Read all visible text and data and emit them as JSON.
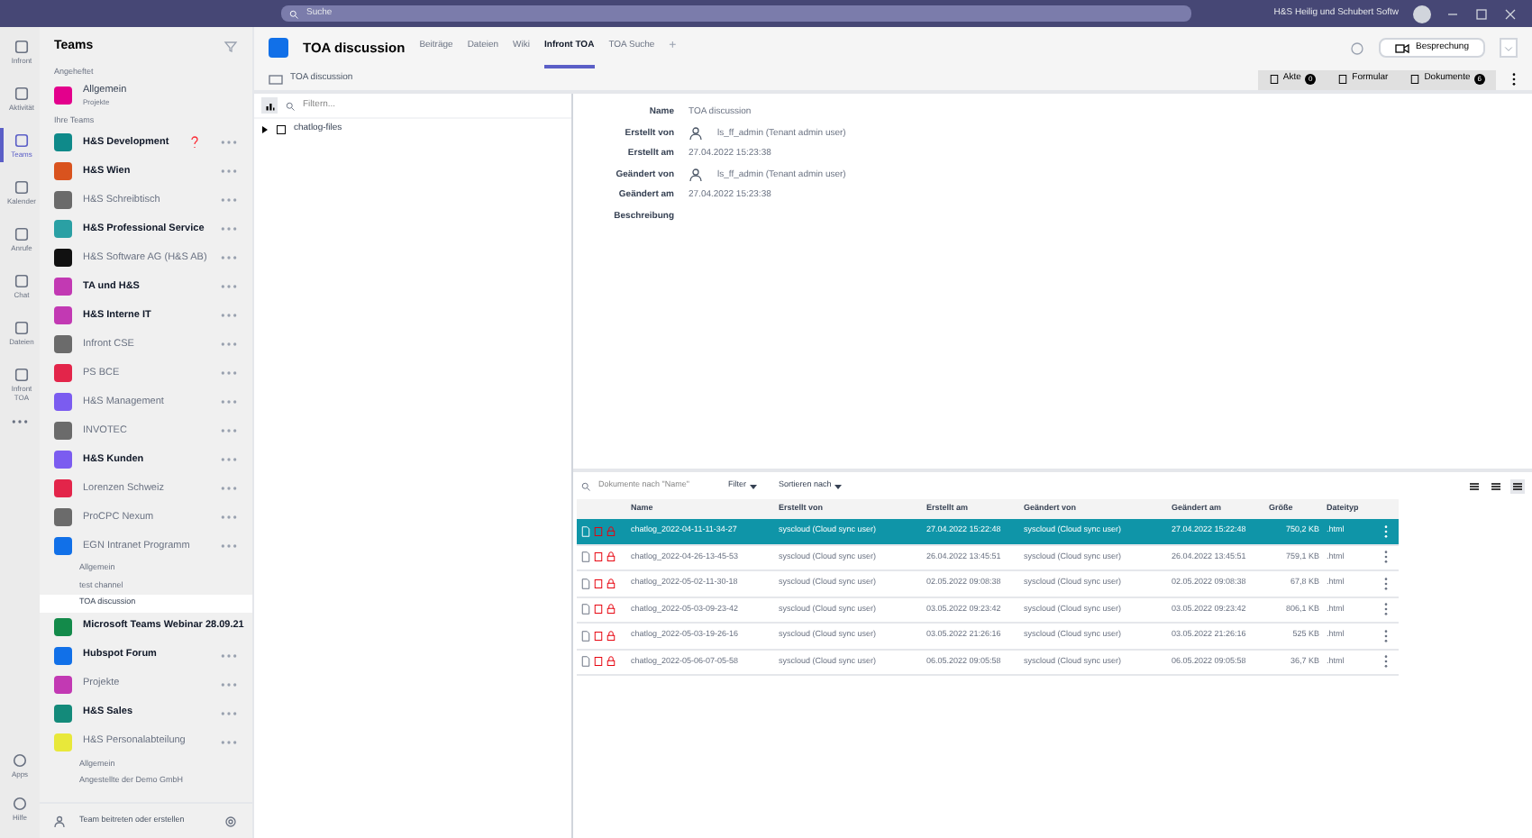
{
  "top_bar": {
    "search_placeholder": "Suche",
    "tenant": "H&S Heilig und Schubert Softw"
  },
  "rail": [
    {
      "label": "Infront",
      "selected": false
    },
    {
      "label": "Aktivität",
      "selected": false
    },
    {
      "label": "Teams",
      "selected": true
    },
    {
      "label": "Kalender",
      "selected": false
    },
    {
      "label": "Anrufe",
      "selected": false
    },
    {
      "label": "Chat",
      "selected": false
    },
    {
      "label": "Dateien",
      "selected": false
    },
    {
      "label": "Infront TOA",
      "selected": false
    }
  ],
  "rail_bottom": [
    {
      "label": "Apps"
    },
    {
      "label": "Hilfe"
    }
  ],
  "teams_panel": {
    "title": "Teams",
    "pinned_heading": "Angeheftet",
    "pinned": {
      "name": "Allgemein",
      "subtitle": "Projekte",
      "color": "#e3008c"
    },
    "teams_heading": "Ihre Teams",
    "footer": "Team beitreten oder erstellen",
    "teams": [
      {
        "name": "H&S Development",
        "bold": true,
        "color": "#0f8a8a",
        "alert": true
      },
      {
        "name": "H&S Wien",
        "bold": true,
        "color": "#d9531e",
        "alert": false
      },
      {
        "name": "H&S Schreibtisch",
        "bold": false,
        "color": "#6b6b6b",
        "alert": false
      },
      {
        "name": "H&S Professional Service",
        "bold": true,
        "color": "#2aa0a4",
        "alert": false
      },
      {
        "name": "H&S Software AG (H&S AB)",
        "bold": false,
        "color": "#111111",
        "alert": false
      },
      {
        "name": "TA und H&S",
        "bold": true,
        "color": "#c239b3",
        "alert": false
      },
      {
        "name": "H&S Interne IT",
        "bold": true,
        "color": "#c239b3",
        "alert": false
      },
      {
        "name": "Infront CSE",
        "bold": false,
        "color": "#6b6b6b",
        "alert": false
      },
      {
        "name": "PS BCE",
        "bold": false,
        "color": "#e3254a",
        "alert": false
      },
      {
        "name": "H&S Management",
        "bold": false,
        "color": "#7b5cf0",
        "alert": false
      },
      {
        "name": "INVOTEC",
        "bold": false,
        "color": "#6b6b6b",
        "alert": false
      },
      {
        "name": "H&S Kunden",
        "bold": true,
        "color": "#7b5cf0",
        "alert": false
      },
      {
        "name": "Lorenzen Schweiz",
        "bold": false,
        "color": "#e3254a",
        "alert": false
      },
      {
        "name": "ProCPC Nexum",
        "bold": false,
        "color": "#6b6b6b",
        "alert": false
      },
      {
        "name": "EGN Intranet Programm",
        "bold": false,
        "color": "#1170e8",
        "alert": false,
        "channels": [
          {
            "name": "Allgemein",
            "selected": false
          },
          {
            "name": "test channel",
            "selected": false
          },
          {
            "name": "TOA discussion",
            "selected": true
          }
        ]
      },
      {
        "name": "Microsoft Teams Webinar 28.09.21",
        "bold": true,
        "color": "#138a4a",
        "alert": false
      },
      {
        "name": "Hubspot Forum",
        "bold": true,
        "color": "#1170e8",
        "alert": false
      },
      {
        "name": "Projekte",
        "bold": false,
        "color": "#c239b3",
        "alert": false
      },
      {
        "name": "H&S Sales",
        "bold": true,
        "color": "#138a7a",
        "alert": false
      },
      {
        "name": "H&S Personalabteilung",
        "bold": false,
        "color": "#e8e83a",
        "alert": false,
        "channels": [
          {
            "name": "Allgemein",
            "selected": false
          },
          {
            "name": "Angestellte der Demo GmbH",
            "selected": false
          }
        ]
      }
    ]
  },
  "channel_header": {
    "title": "TOA discussion",
    "tabs": [
      {
        "label": "Beiträge",
        "selected": false
      },
      {
        "label": "Dateien",
        "selected": false
      },
      {
        "label": "Wiki",
        "selected": false
      },
      {
        "label": "Infront TOA",
        "selected": true
      },
      {
        "label": "TOA Suche",
        "selected": false
      }
    ],
    "add": "+",
    "meeting_button": "Besprechung"
  },
  "breadcrumb": "TOA discussion",
  "toolbar": [
    {
      "label": "Akte",
      "count": "0"
    },
    {
      "label": "Formular"
    },
    {
      "label": "Dokumente",
      "count": "6"
    }
  ],
  "tree": {
    "filter_placeholder": "Filtern...",
    "items": [
      {
        "name": "chatlog-files",
        "expanded": false
      }
    ]
  },
  "details": [
    {
      "label": "Name",
      "value": "TOA discussion",
      "kind": "text"
    },
    {
      "label": "Erstellt von",
      "value": "ls_ff_admin (Tenant admin user)",
      "kind": "user"
    },
    {
      "label": "Erstellt am",
      "value": "27.04.2022 15:23:38",
      "kind": "text"
    },
    {
      "label": "Geändert von",
      "value": "ls_ff_admin (Tenant admin user)",
      "kind": "user"
    },
    {
      "label": "Geändert am",
      "value": "27.04.2022 15:23:38",
      "kind": "text"
    },
    {
      "label": "Beschreibung",
      "kind": "text"
    }
  ],
  "documents": {
    "search_placeholder": "Dokumente nach \"Name\"",
    "filter": "Filter",
    "sort": "Sortieren nach",
    "columns": [
      "Name",
      "Erstellt von",
      "Erstellt am",
      "Geändert von",
      "Geändert am",
      "Größe",
      "Dateityp"
    ],
    "rows": [
      {
        "selected": true,
        "cells": [
          "chatlog_2022-04-11-11-34-27",
          "syscloud (Cloud sync user)",
          "27.04.2022 15:22:48",
          "syscloud (Cloud sync user)",
          "27.04.2022 15:22:48",
          "750,2 KB",
          ".html"
        ]
      },
      {
        "selected": false,
        "cells": [
          "chatlog_2022-04-26-13-45-53",
          "syscloud (Cloud sync user)",
          "26.04.2022 13:45:51",
          "syscloud (Cloud sync user)",
          "26.04.2022 13:45:51",
          "759,1 KB",
          ".html"
        ]
      },
      {
        "selected": false,
        "cells": [
          "chatlog_2022-05-02-11-30-18",
          "syscloud (Cloud sync user)",
          "02.05.2022 09:08:38",
          "syscloud (Cloud sync user)",
          "02.05.2022 09:08:38",
          "67,8 KB",
          ".html"
        ]
      },
      {
        "selected": false,
        "cells": [
          "chatlog_2022-05-03-09-23-42",
          "syscloud (Cloud sync user)",
          "03.05.2022 09:23:42",
          "syscloud (Cloud sync user)",
          "03.05.2022 09:23:42",
          "806,1 KB",
          ".html"
        ]
      },
      {
        "selected": false,
        "cells": [
          "chatlog_2022-05-03-19-26-16",
          "syscloud (Cloud sync user)",
          "03.05.2022 21:26:16",
          "syscloud (Cloud sync user)",
          "03.05.2022 21:26:16",
          "525 KB",
          ".html"
        ]
      },
      {
        "selected": false,
        "cells": [
          "chatlog_2022-05-06-07-05-58",
          "syscloud (Cloud sync user)",
          "06.05.2022 09:05:58",
          "syscloud (Cloud sync user)",
          "06.05.2022 09:05:58",
          "36,7 KB",
          ".html"
        ]
      }
    ]
  }
}
